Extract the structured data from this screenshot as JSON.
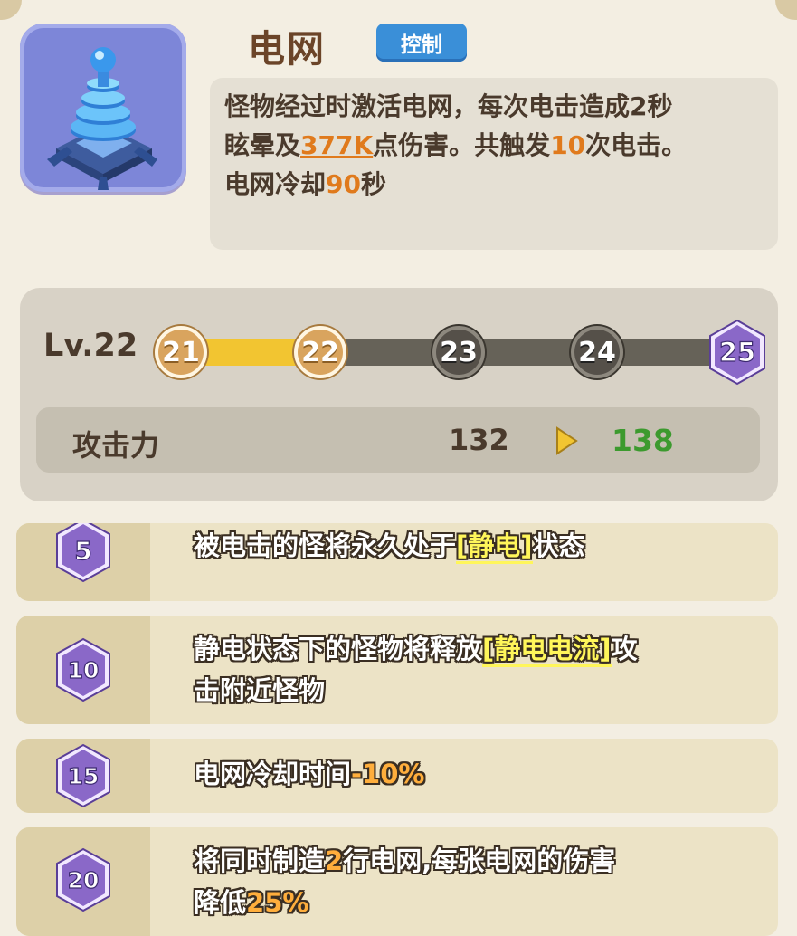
{
  "skill": {
    "name": "电网",
    "tag": "控制",
    "desc_line1": "怪物经过时激活电网，每次电击造成2秒",
    "desc_line2_a": "眩晕及",
    "desc_line2_damage": "377K",
    "desc_line2_b": "点伤害。共触发",
    "desc_line2_count": "10",
    "desc_line2_c": "次电击。",
    "desc_line3_a": "电网冷却",
    "desc_line3_cd": "90",
    "desc_line3_b": "秒",
    "icon": "tesla-tower-icon"
  },
  "level": {
    "label": "Lv.22",
    "current": 22,
    "nodes": [
      "21",
      "22",
      "23",
      "24",
      "25"
    ],
    "progress_completed_nodes": 2
  },
  "stat": {
    "name": "攻击力",
    "current": "132",
    "next": "138"
  },
  "perks": [
    {
      "level": "5",
      "text_a": "被电击的怪将永久处于",
      "keyword": "[静电]",
      "text_b": "状态"
    },
    {
      "level": "10",
      "text_a": "静电状态下的怪物将释放",
      "keyword": "[静电电流]",
      "text_b": "攻",
      "text_c": "击附近怪物"
    },
    {
      "level": "15",
      "text_a": "电网冷却时间",
      "value": "-10%"
    },
    {
      "level": "20",
      "text_a": "将同时制造",
      "value": "2",
      "text_b": "行电网,每张电网的伤害",
      "text_c": "降低",
      "value2": "25%"
    }
  ],
  "colors": {
    "accent_orange": "#e07a1c",
    "progress_fill": "#f2c531",
    "level_max_purple": "#8a68c8",
    "stat_up_green": "#3c9a2e",
    "tag_blue": "#3a8fd8"
  }
}
